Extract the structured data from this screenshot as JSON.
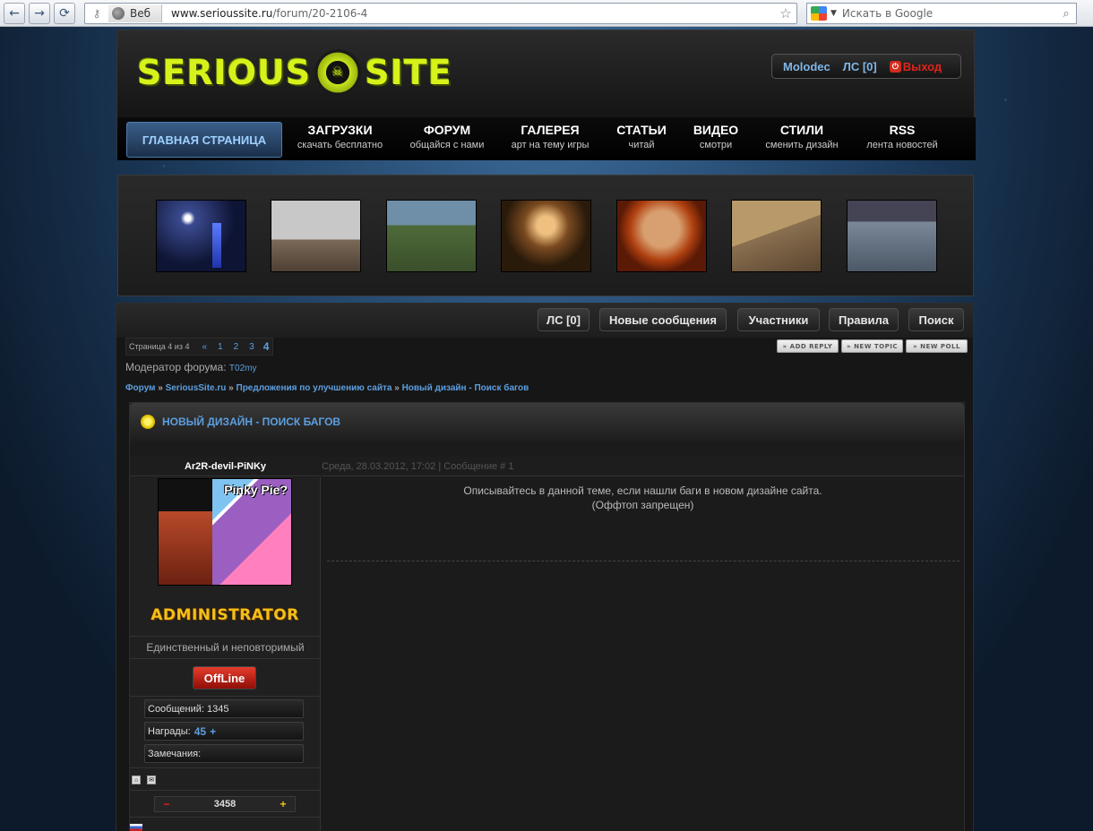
{
  "browser": {
    "back_icon": "arrow-left-icon",
    "forward_icon": "arrow-right-icon",
    "reload_icon": "reload-icon",
    "web_chip_label": "Веб",
    "url_domain": "www.serioussite.ru",
    "url_path": "/forum/20-2106-4",
    "search_placeholder": "Искать в Google"
  },
  "header": {
    "logo_left": "SERIOUS",
    "logo_right": "SITE",
    "user_name": "Molodec",
    "pm_label": "ЛС [0]",
    "logout_label": "Выход"
  },
  "nav": {
    "home": "ГЛАВНАЯ СТРАНИЦА",
    "items": [
      {
        "title": "ЗАГРУЗКИ",
        "sub": "скачать бесплатно"
      },
      {
        "title": "ФОРУМ",
        "sub": "общайся с нами"
      },
      {
        "title": "ГАЛЕРЕЯ",
        "sub": "арт на тему игры"
      },
      {
        "title": "СТАТЬИ",
        "sub": "читай"
      },
      {
        "title": "ВИДЕО",
        "sub": "смотри"
      },
      {
        "title": "СТИЛИ",
        "sub": "сменить дизайн"
      },
      {
        "title": "RSS",
        "sub": "лента новостей"
      }
    ]
  },
  "forum_buttons": {
    "pm": "ЛС [0]",
    "new_messages": "Новые сообщения",
    "members": "Участники",
    "rules": "Правила",
    "search": "Поиск"
  },
  "pager": {
    "label": "Страница 4 из 4",
    "prev": "«",
    "pages": [
      "1",
      "2",
      "3"
    ],
    "current": "4"
  },
  "action_buttons": {
    "add_reply": "ADD REPLY",
    "new_topic": "NEW TOPIC",
    "new_poll": "NEW POLL"
  },
  "moderator": {
    "label": "Модератор форума:",
    "name": "T02my"
  },
  "breadcrumb": {
    "items": [
      "Форум",
      "SeriousSite.ru",
      "Предложения по улучшению сайта",
      "Новый дизайн - Поиск багов"
    ],
    "separator": "»"
  },
  "topic": {
    "title": "НОВЫЙ ДИЗАЙН - ПОИСК БАГОВ"
  },
  "post": {
    "author": "Ar2R-devil-PiNKy",
    "meta": "Среда, 28.03.2012, 17:02 | Сообщение # 1",
    "avatar_caption": "Pinky Pie?",
    "rank": "ADMINISTRATOR",
    "user_status": "Единственный и неповторимый",
    "online_state": "OffLine",
    "messages_label": "Сообщений:",
    "messages_value": "1345",
    "awards_label": "Награды:",
    "awards_value": "45",
    "awards_plus": "+",
    "warnings_label": "Замечания:",
    "reputation_value": "3458",
    "rep_minus": "−",
    "rep_plus": "+",
    "body_line1": "Описывайтесь в данной теме, если нашли баги в новом дизайне сайта.",
    "body_line2": "(Оффтоп запрещен)"
  }
}
